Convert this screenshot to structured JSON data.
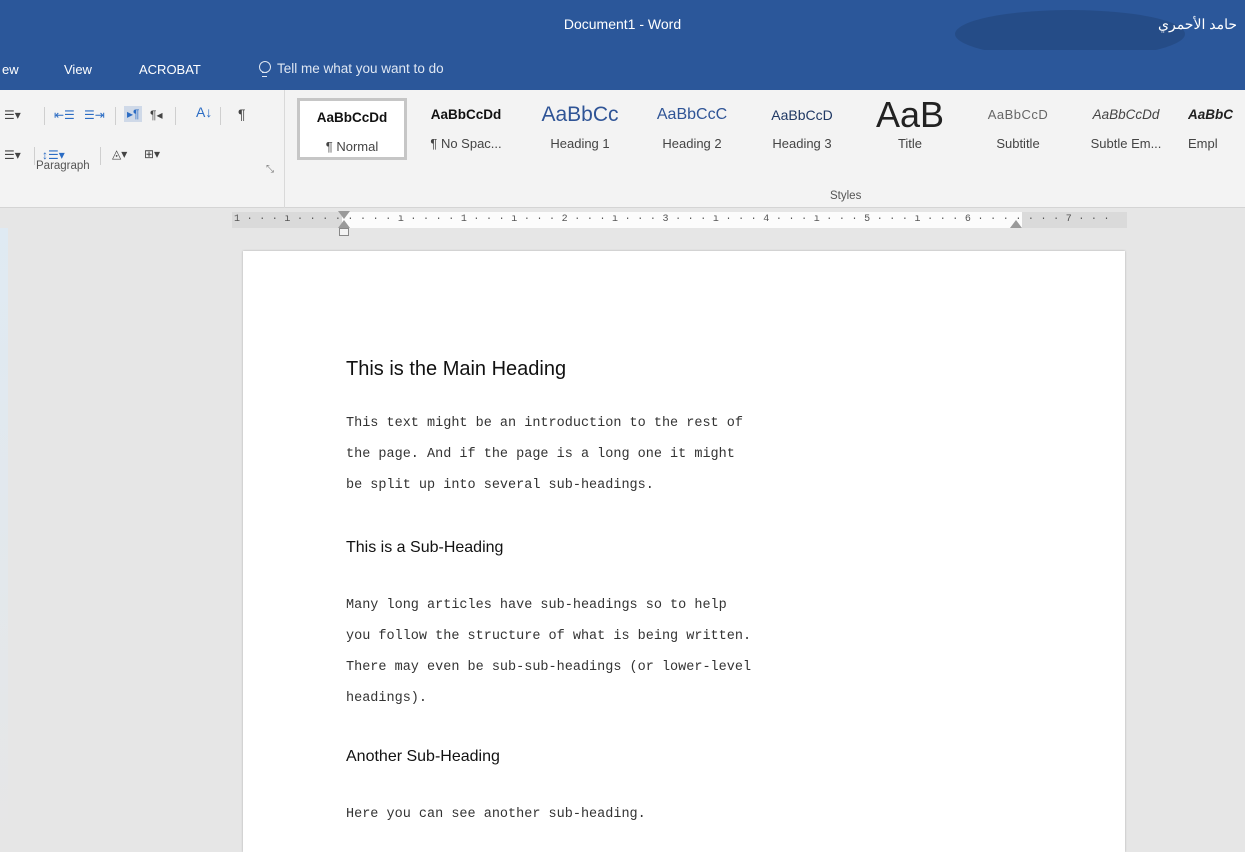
{
  "window": {
    "title": "Document1  -  Word",
    "user_name": "حامد الأحمري"
  },
  "ribbon_tabs": [
    "ew",
    "View",
    "ACROBAT"
  ],
  "tell_me": {
    "placeholder": "Tell me what you want to do",
    "icon": "lightbulb-icon"
  },
  "ribbon": {
    "paragraph_label": "Paragraph",
    "styles_label": "Styles",
    "paragraph_icons": [
      "multilevel-list-icon",
      "decrease-indent-icon",
      "increase-indent-icon",
      "ltr-icon",
      "rtl-icon",
      "sort-icon",
      "show-formatting-icon",
      "align-icon",
      "line-spacing-icon",
      "shading-icon",
      "borders-icon"
    ]
  },
  "styles": [
    {
      "preview": "AaBbCcDd",
      "name": "¶ Normal",
      "selected": true
    },
    {
      "preview": "AaBbCcDd",
      "name": "¶ No Spac..."
    },
    {
      "preview": "AaBbCc",
      "name": "Heading 1"
    },
    {
      "preview": "AaBbCcC",
      "name": "Heading 2"
    },
    {
      "preview": "AaBbCcD",
      "name": "Heading 3"
    },
    {
      "preview": "AaB",
      "name": "Title"
    },
    {
      "preview": "AaBbCcD",
      "name": "Subtitle"
    },
    {
      "preview": "AaBbCcDd",
      "name": "Subtle Em..."
    },
    {
      "preview": "AaBbC",
      "name": "Empl"
    }
  ],
  "ruler": {
    "text": "1 · · · ı · · · · · · · · ı · · · · 1 · · · ı · · · 2 · · · ı · · · 3 · · · ı · · · 4 · · · ı · · · 5 · · · ı · · · 6 · · · · · · · 7 · · ·"
  },
  "document": {
    "main_heading": "This is the Main Heading",
    "intro": [
      "This text might be an introduction to the rest of",
      "the page. And if the page is a long one it might",
      "be split up into several sub-headings."
    ],
    "sub_heading_1": "This is a Sub-Heading",
    "para_1": [
      "Many long articles have sub-headings so to help",
      "you follow the structure of what is being written.",
      "There may even be sub-sub-headings (or lower-level",
      "headings)."
    ],
    "sub_heading_2": "Another Sub-Heading",
    "para_2": [
      "Here you can see another sub-heading."
    ]
  },
  "colors": {
    "title_bar": "#2b579a",
    "ribbon_bg": "#f3f3f3",
    "canvas_bg": "#e6e6e6",
    "heading_blue": "#2f5496"
  }
}
